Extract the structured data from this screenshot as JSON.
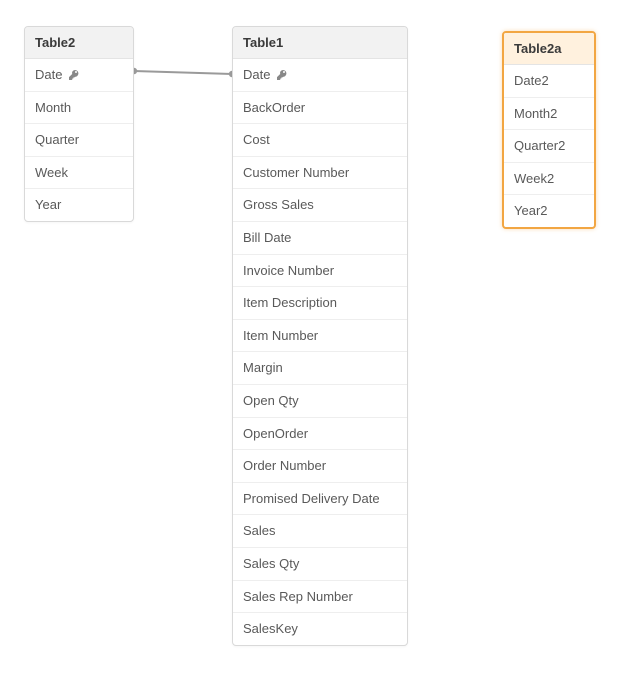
{
  "tables": {
    "table2": {
      "title": "Table2",
      "fields": [
        {
          "name": "Date",
          "key": true
        },
        {
          "name": "Month",
          "key": false
        },
        {
          "name": "Quarter",
          "key": false
        },
        {
          "name": "Week",
          "key": false
        },
        {
          "name": "Year",
          "key": false
        }
      ]
    },
    "table1": {
      "title": "Table1",
      "fields": [
        {
          "name": "Date",
          "key": true
        },
        {
          "name": "BackOrder",
          "key": false
        },
        {
          "name": "Cost",
          "key": false
        },
        {
          "name": "Customer Number",
          "key": false
        },
        {
          "name": "Gross Sales",
          "key": false
        },
        {
          "name": "Bill Date",
          "key": false
        },
        {
          "name": "Invoice Number",
          "key": false
        },
        {
          "name": "Item Description",
          "key": false
        },
        {
          "name": "Item Number",
          "key": false
        },
        {
          "name": "Margin",
          "key": false
        },
        {
          "name": "Open Qty",
          "key": false
        },
        {
          "name": "OpenOrder",
          "key": false
        },
        {
          "name": "Order Number",
          "key": false
        },
        {
          "name": "Promised Delivery Date",
          "key": false
        },
        {
          "name": "Sales",
          "key": false
        },
        {
          "name": "Sales Qty",
          "key": false
        },
        {
          "name": "Sales Rep Number",
          "key": false
        },
        {
          "name": "SalesKey",
          "key": false
        }
      ]
    },
    "table2a": {
      "title": "Table2a",
      "fields": [
        {
          "name": "Date2",
          "key": false
        },
        {
          "name": "Month2",
          "key": false
        },
        {
          "name": "Quarter2",
          "key": false
        },
        {
          "name": "Week2",
          "key": false
        },
        {
          "name": "Year2",
          "key": false
        }
      ]
    }
  },
  "relations": [
    {
      "from": "table2.Date",
      "to": "table1.Date"
    }
  ],
  "colors": {
    "highlight_border": "#f2a642",
    "box_border": "#d9d9d9",
    "header_bg": "#f2f2f2",
    "link": "#9a9a9a"
  }
}
